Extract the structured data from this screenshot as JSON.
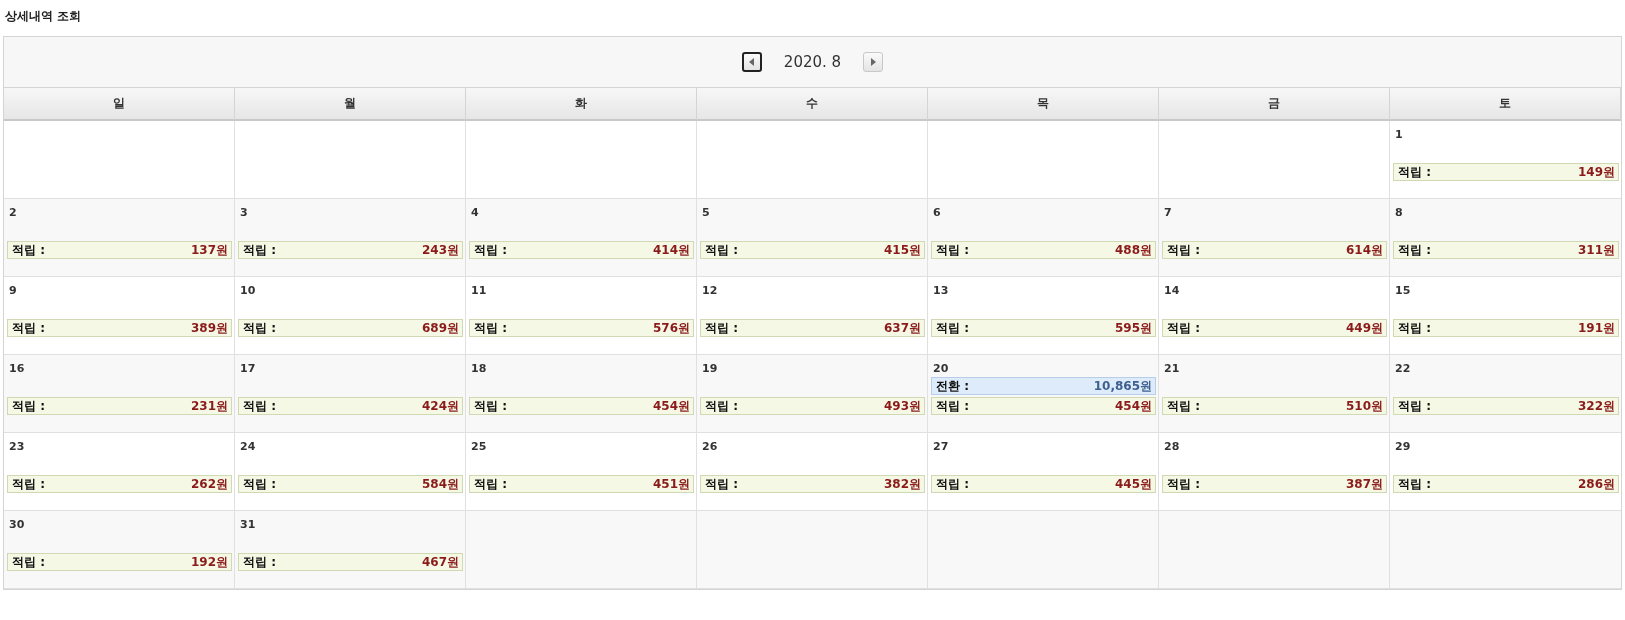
{
  "title": "상세내역 조회",
  "nav": {
    "month": "2020. 8",
    "prev_focused": true
  },
  "weekdays": [
    "일",
    "월",
    "화",
    "수",
    "목",
    "금",
    "토"
  ],
  "weeks": [
    {
      "cells": [
        {
          "kind": "blank"
        },
        {
          "kind": "blank"
        },
        {
          "kind": "blank"
        },
        {
          "kind": "blank"
        },
        {
          "kind": "blank"
        },
        {
          "kind": "blank"
        },
        {
          "kind": "day",
          "day": "1",
          "entries": [
            {
              "kind": "earn",
              "label": "적립 :",
              "amount": "149원"
            }
          ]
        }
      ]
    },
    {
      "cells": [
        {
          "kind": "day",
          "day": "2",
          "entries": [
            {
              "kind": "earn",
              "label": "적립 :",
              "amount": "137원"
            }
          ]
        },
        {
          "kind": "day",
          "day": "3",
          "entries": [
            {
              "kind": "earn",
              "label": "적립 :",
              "amount": "243원"
            }
          ]
        },
        {
          "kind": "day",
          "day": "4",
          "entries": [
            {
              "kind": "earn",
              "label": "적립 :",
              "amount": "414원"
            }
          ]
        },
        {
          "kind": "day",
          "day": "5",
          "entries": [
            {
              "kind": "earn",
              "label": "적립 :",
              "amount": "415원"
            }
          ]
        },
        {
          "kind": "day",
          "day": "6",
          "entries": [
            {
              "kind": "earn",
              "label": "적립 :",
              "amount": "488원"
            }
          ]
        },
        {
          "kind": "day",
          "day": "7",
          "entries": [
            {
              "kind": "earn",
              "label": "적립 :",
              "amount": "614원"
            }
          ]
        },
        {
          "kind": "day",
          "day": "8",
          "entries": [
            {
              "kind": "earn",
              "label": "적립 :",
              "amount": "311원"
            }
          ]
        }
      ]
    },
    {
      "cells": [
        {
          "kind": "day",
          "day": "9",
          "entries": [
            {
              "kind": "earn",
              "label": "적립 :",
              "amount": "389원"
            }
          ]
        },
        {
          "kind": "day",
          "day": "10",
          "entries": [
            {
              "kind": "earn",
              "label": "적립 :",
              "amount": "689원"
            }
          ]
        },
        {
          "kind": "day",
          "day": "11",
          "entries": [
            {
              "kind": "earn",
              "label": "적립 :",
              "amount": "576원"
            }
          ]
        },
        {
          "kind": "day",
          "day": "12",
          "entries": [
            {
              "kind": "earn",
              "label": "적립 :",
              "amount": "637원"
            }
          ]
        },
        {
          "kind": "day",
          "day": "13",
          "entries": [
            {
              "kind": "earn",
              "label": "적립 :",
              "amount": "595원"
            }
          ]
        },
        {
          "kind": "day",
          "day": "14",
          "entries": [
            {
              "kind": "earn",
              "label": "적립 :",
              "amount": "449원"
            }
          ]
        },
        {
          "kind": "day",
          "day": "15",
          "entries": [
            {
              "kind": "earn",
              "label": "적립 :",
              "amount": "191원"
            }
          ]
        }
      ]
    },
    {
      "cells": [
        {
          "kind": "day",
          "day": "16",
          "entries": [
            {
              "kind": "earn",
              "label": "적립 :",
              "amount": "231원"
            }
          ]
        },
        {
          "kind": "day",
          "day": "17",
          "entries": [
            {
              "kind": "earn",
              "label": "적립 :",
              "amount": "424원"
            }
          ]
        },
        {
          "kind": "day",
          "day": "18",
          "entries": [
            {
              "kind": "earn",
              "label": "적립 :",
              "amount": "454원"
            }
          ]
        },
        {
          "kind": "day",
          "day": "19",
          "entries": [
            {
              "kind": "earn",
              "label": "적립 :",
              "amount": "493원"
            }
          ]
        },
        {
          "kind": "day",
          "day": "20",
          "entries": [
            {
              "kind": "convert",
              "label": "전환 :",
              "amount": "10,865원"
            },
            {
              "kind": "earn",
              "label": "적립 :",
              "amount": "454원"
            }
          ]
        },
        {
          "kind": "day",
          "day": "21",
          "entries": [
            {
              "kind": "earn",
              "label": "적립 :",
              "amount": "510원"
            }
          ]
        },
        {
          "kind": "day",
          "day": "22",
          "entries": [
            {
              "kind": "earn",
              "label": "적립 :",
              "amount": "322원"
            }
          ]
        }
      ]
    },
    {
      "cells": [
        {
          "kind": "day",
          "day": "23",
          "entries": [
            {
              "kind": "earn",
              "label": "적립 :",
              "amount": "262원"
            }
          ]
        },
        {
          "kind": "day",
          "day": "24",
          "entries": [
            {
              "kind": "earn",
              "label": "적립 :",
              "amount": "584원"
            }
          ]
        },
        {
          "kind": "day",
          "day": "25",
          "entries": [
            {
              "kind": "earn",
              "label": "적립 :",
              "amount": "451원"
            }
          ]
        },
        {
          "kind": "day",
          "day": "26",
          "entries": [
            {
              "kind": "earn",
              "label": "적립 :",
              "amount": "382원"
            }
          ]
        },
        {
          "kind": "day",
          "day": "27",
          "entries": [
            {
              "kind": "earn",
              "label": "적립 :",
              "amount": "445원"
            }
          ]
        },
        {
          "kind": "day",
          "day": "28",
          "entries": [
            {
              "kind": "earn",
              "label": "적립 :",
              "amount": "387원"
            }
          ]
        },
        {
          "kind": "day",
          "day": "29",
          "entries": [
            {
              "kind": "earn",
              "label": "적립 :",
              "amount": "286원"
            }
          ]
        }
      ]
    },
    {
      "cells": [
        {
          "kind": "day",
          "day": "30",
          "entries": [
            {
              "kind": "earn",
              "label": "적립 :",
              "amount": "192원"
            }
          ]
        },
        {
          "kind": "day",
          "day": "31",
          "entries": [
            {
              "kind": "earn",
              "label": "적립 :",
              "amount": "467원"
            }
          ]
        },
        {
          "kind": "blank"
        },
        {
          "kind": "blank"
        },
        {
          "kind": "blank"
        },
        {
          "kind": "blank"
        },
        {
          "kind": "blank"
        }
      ]
    }
  ]
}
